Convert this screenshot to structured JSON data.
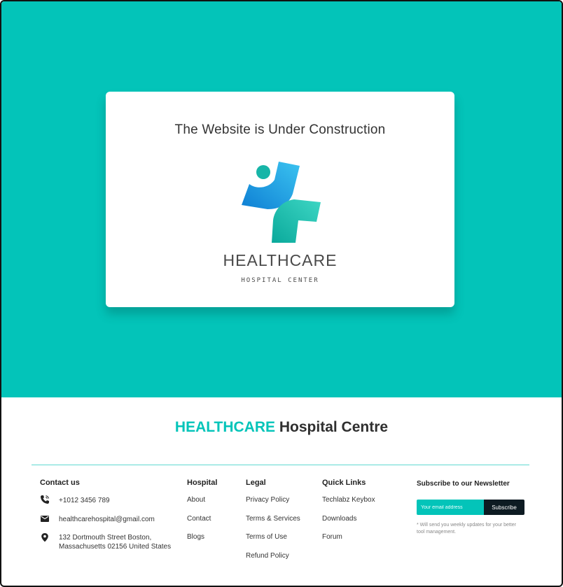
{
  "hero": {
    "title": "The Website is Under Construction",
    "brand_word": "HEALTHCARE",
    "brand_sub": "HOSPITAL CENTER"
  },
  "footer": {
    "title_accent": "HEALTHCARE",
    "title_rest": " Hospital Centre",
    "contact": {
      "heading": "Contact us",
      "phone": "+1012 3456 789",
      "email": "healthcarehospital@gmail.com",
      "address_line1": "132 Dortmouth Street Boston,",
      "address_line2": "Massachusetts 02156 United States"
    },
    "hospital": {
      "heading": "Hospital",
      "links": [
        "About",
        "Contact",
        "Blogs"
      ]
    },
    "legal": {
      "heading": "Legal",
      "links": [
        "Privacy Policy",
        "Terms & Services",
        "Terms of Use",
        "Refund Policy"
      ]
    },
    "quick_links": {
      "heading": "Quick Links",
      "links": [
        "Techlabz Keybox",
        "Downloads",
        "Forum"
      ]
    },
    "newsletter": {
      "heading": "Subscribe to our Newsletter",
      "placeholder": "Your email address",
      "button": "Subscribe",
      "note": "* Will send you weekly updates for your better tool management."
    }
  },
  "colors": {
    "accent": "#03c4b9",
    "dark_button": "#0d1b22",
    "logo_blue": "#1aa0e0",
    "logo_teal": "#15b8a8"
  }
}
